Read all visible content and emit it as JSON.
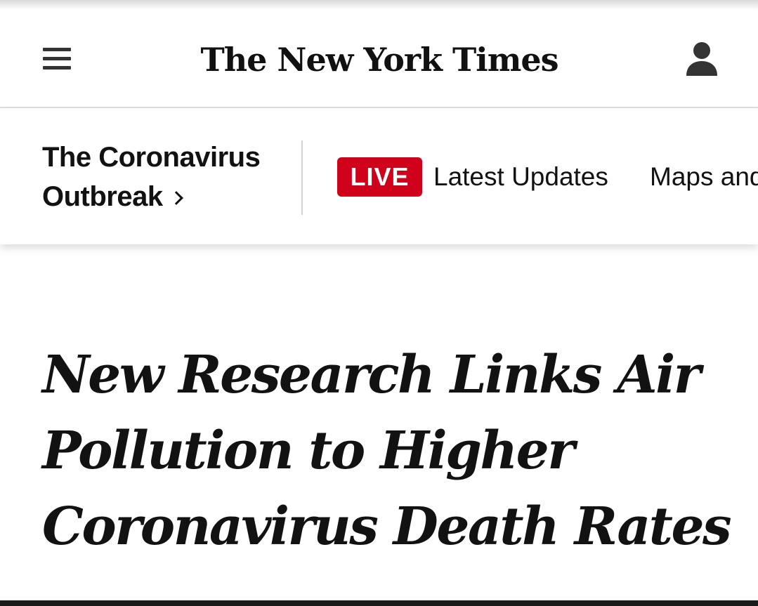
{
  "masthead": {
    "logo_text": "The New York Times",
    "menu_icon": "hamburger-menu-icon",
    "account_icon": "user-account-icon"
  },
  "nav": {
    "section_line1": "The Coronavirus",
    "section_line2": "Outbreak",
    "live_label": "LIVE",
    "links": [
      "Latest Updates",
      "Maps and"
    ]
  },
  "article": {
    "headline": "New Research Links Air Pollution to Higher Coronavirus Death Rates"
  },
  "colors": {
    "live_badge": "#d0021b",
    "text": "#121212"
  }
}
